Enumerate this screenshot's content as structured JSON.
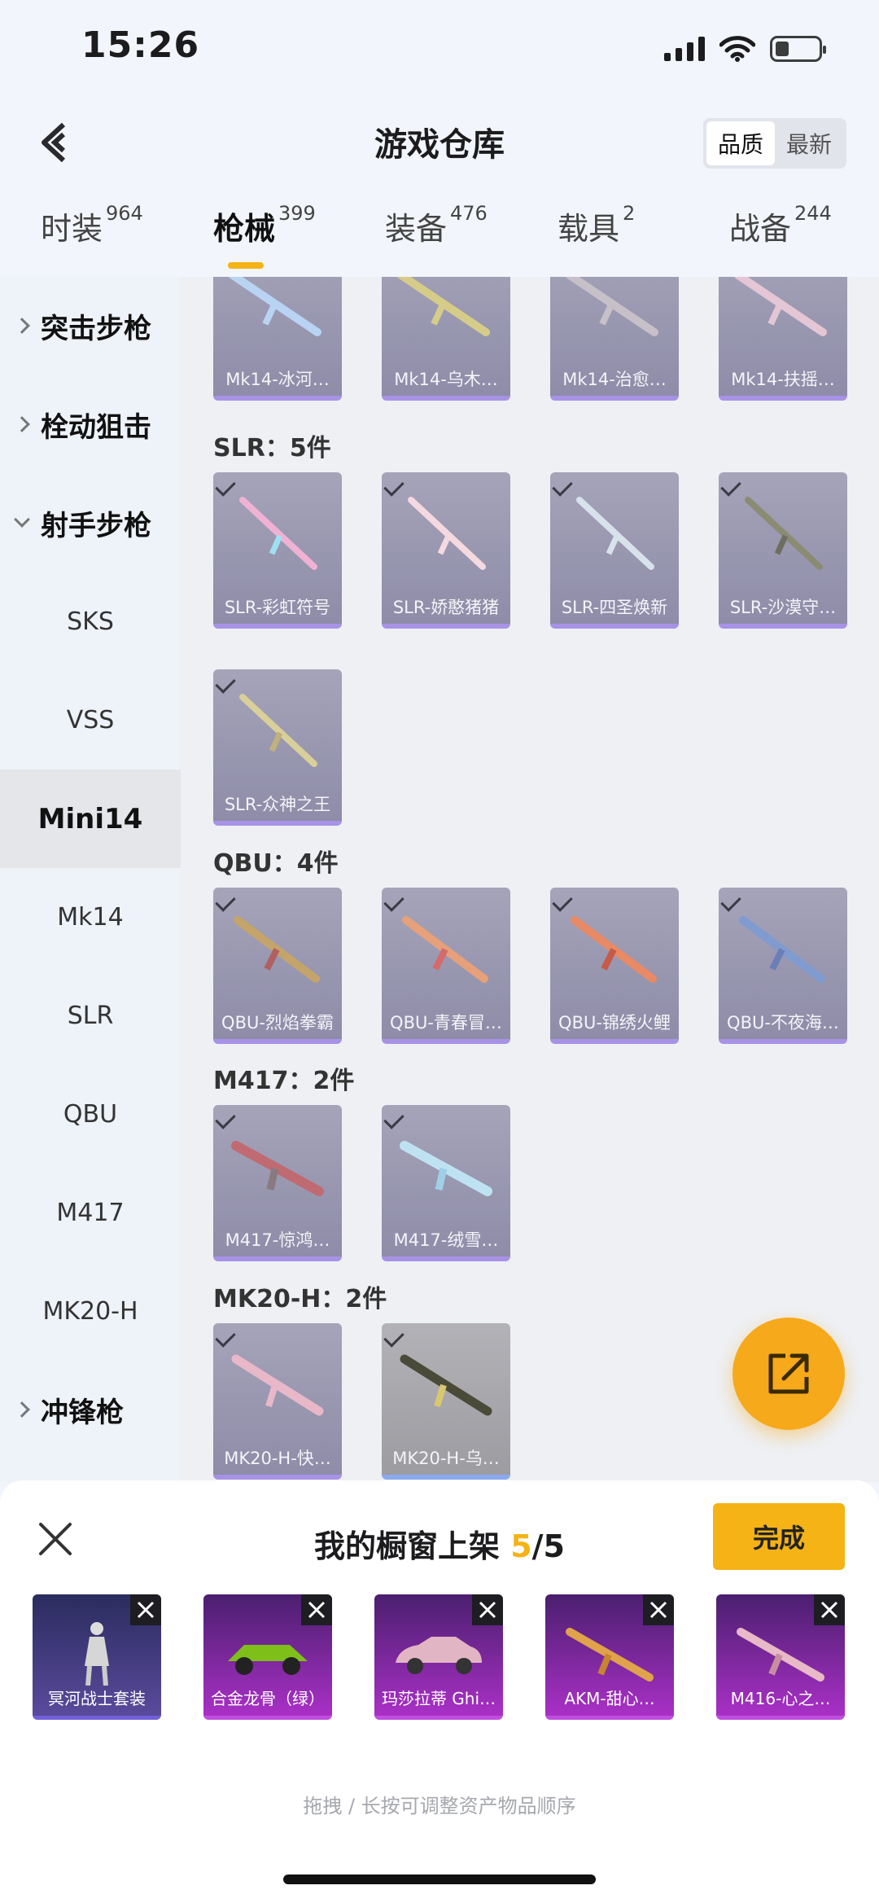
{
  "status": {
    "time": "15:26"
  },
  "header": {
    "title": "游戏仓库",
    "sort_options": [
      "品质",
      "最新"
    ],
    "active_sort": "品质"
  },
  "tabs": [
    {
      "label": "时装",
      "count": "964"
    },
    {
      "label": "枪械",
      "count": "399"
    },
    {
      "label": "装备",
      "count": "476"
    },
    {
      "label": "载具",
      "count": "2"
    },
    {
      "label": "战备",
      "count": "244"
    }
  ],
  "sidebar": {
    "items": [
      {
        "label": "突击步枪",
        "type": "category"
      },
      {
        "label": "栓动狙击",
        "type": "category"
      },
      {
        "label": "射手步枪",
        "type": "category-open"
      },
      {
        "label": "SKS",
        "type": "sub"
      },
      {
        "label": "VSS",
        "type": "sub"
      },
      {
        "label": "Mini14",
        "type": "sub-active"
      },
      {
        "label": "Mk14",
        "type": "sub"
      },
      {
        "label": "SLR",
        "type": "sub"
      },
      {
        "label": "QBU",
        "type": "sub"
      },
      {
        "label": "M417",
        "type": "sub"
      },
      {
        "label": "MK20-H",
        "type": "sub"
      },
      {
        "label": "冲锋枪",
        "type": "category"
      }
    ]
  },
  "sections": {
    "mk14": {
      "items": [
        "Mk14-冰河…",
        "Mk14-乌木…",
        "Mk14-治愈…",
        "Mk14-扶摇…"
      ]
    },
    "slr": {
      "label": "SLR：5件",
      "items": [
        "SLR-彩虹符号",
        "SLR-娇憨猪猪",
        "SLR-四圣焕新",
        "SLR-沙漠守…",
        "SLR-众神之王"
      ]
    },
    "qbu": {
      "label": "QBU：4件",
      "items": [
        "QBU-烈焰拳霸",
        "QBU-青春冒…",
        "QBU-锦绣火鲤",
        "QBU-不夜海…"
      ]
    },
    "m417": {
      "label": "M417：2件",
      "items": [
        "M417-惊鸿…",
        "M417-绒雪…"
      ]
    },
    "mk20h": {
      "label": "MK20-H：2件",
      "items": [
        "MK20-H-快…",
        "MK20-H-乌…"
      ]
    }
  },
  "sheet": {
    "title_prefix": "我的橱窗上架 ",
    "count": "5",
    "total": "/5",
    "done_label": "完成",
    "items": [
      "冥河战士套装",
      "合金龙骨（绿）",
      "玛莎拉蒂 Ghi…",
      "AKM-甜心…",
      "M416-心之…"
    ],
    "hint": "拖拽 / 长按可调整资产物品顺序"
  },
  "colors": {
    "accent": "#f5b316",
    "card_purple": "#a892e6",
    "shelf_purple": "#c04ee0"
  }
}
